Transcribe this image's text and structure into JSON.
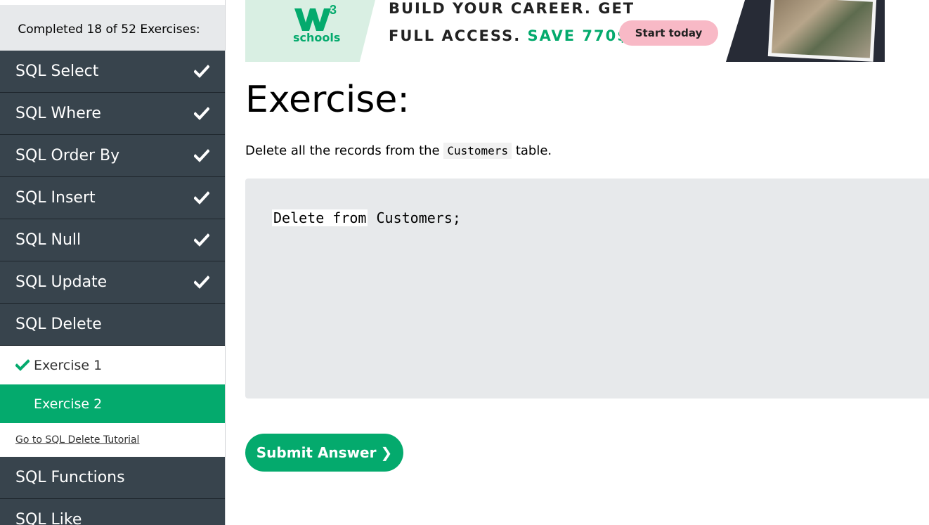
{
  "sidebar": {
    "progress_text": "Completed 18 of 52 Exercises:",
    "items": [
      {
        "label": "SQL Select",
        "completed": true
      },
      {
        "label": "SQL Where",
        "completed": true
      },
      {
        "label": "SQL Order By",
        "completed": true
      },
      {
        "label": "SQL Insert",
        "completed": true
      },
      {
        "label": "SQL Null",
        "completed": true
      },
      {
        "label": "SQL Update",
        "completed": true
      },
      {
        "label": "SQL Delete",
        "completed": false
      }
    ],
    "sub_items": [
      {
        "label": "Exercise 1",
        "completed": true,
        "active": false
      },
      {
        "label": "Exercise 2",
        "completed": false,
        "active": true
      }
    ],
    "tutorial_link": "Go to SQL Delete Tutorial",
    "more_items": [
      {
        "label": "SQL Functions"
      },
      {
        "label": "SQL Like"
      }
    ]
  },
  "ad": {
    "logo_text": "schools",
    "logo_superscript": "3",
    "line1": "BUILD YOUR CAREER. GET",
    "line2_prefix": "FULL ACCESS.",
    "line2_accent": "SAVE 770$",
    "button_label": "Start today"
  },
  "exercise": {
    "title": "Exercise:",
    "desc_prefix": "Delete all the records from the",
    "desc_code": "Customers",
    "desc_suffix": "table.",
    "code_input_value": "Delete from",
    "code_rest": " Customers;",
    "submit_label": "Submit Answer",
    "submit_arrow": "❯"
  },
  "colors": {
    "accent": "#04aa6d",
    "sidebar_dark": "#38444d",
    "code_bg": "#e7e9eb",
    "ad_button": "#f8b9c6"
  },
  "icons": {
    "check": "check-icon",
    "check_green": "check-green-icon"
  }
}
